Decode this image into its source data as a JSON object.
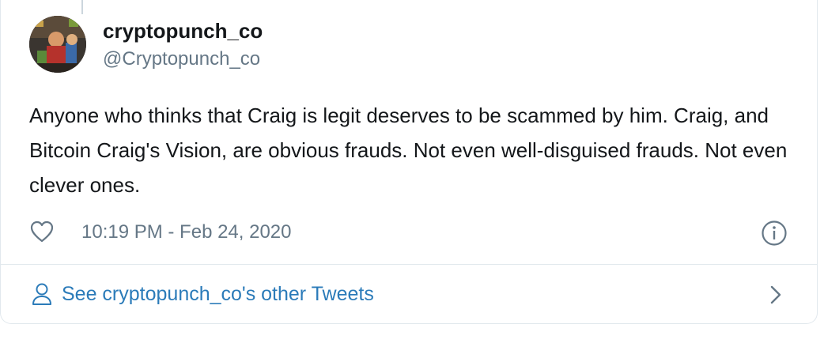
{
  "tweet": {
    "display_name": "cryptopunch_co",
    "handle": "@Cryptopunch_co",
    "text": "Anyone who thinks that Craig is legit deserves to be scammed by him. Craig, and Bitcoin Craig's Vision, are obvious frauds. Not even well-disguised frauds. Not even clever ones.",
    "timestamp": "10:19 PM - Feb 24, 2020"
  },
  "footer": {
    "link_label": "See cryptopunch_co's other Tweets"
  },
  "icons": {
    "like": "heart-icon",
    "info": "info-icon",
    "profile": "person-icon",
    "more": "chevron-right-icon"
  },
  "colors": {
    "text_primary": "#14171a",
    "text_secondary": "#657786",
    "link": "#2b7bb9",
    "border": "#e1e8ed"
  }
}
